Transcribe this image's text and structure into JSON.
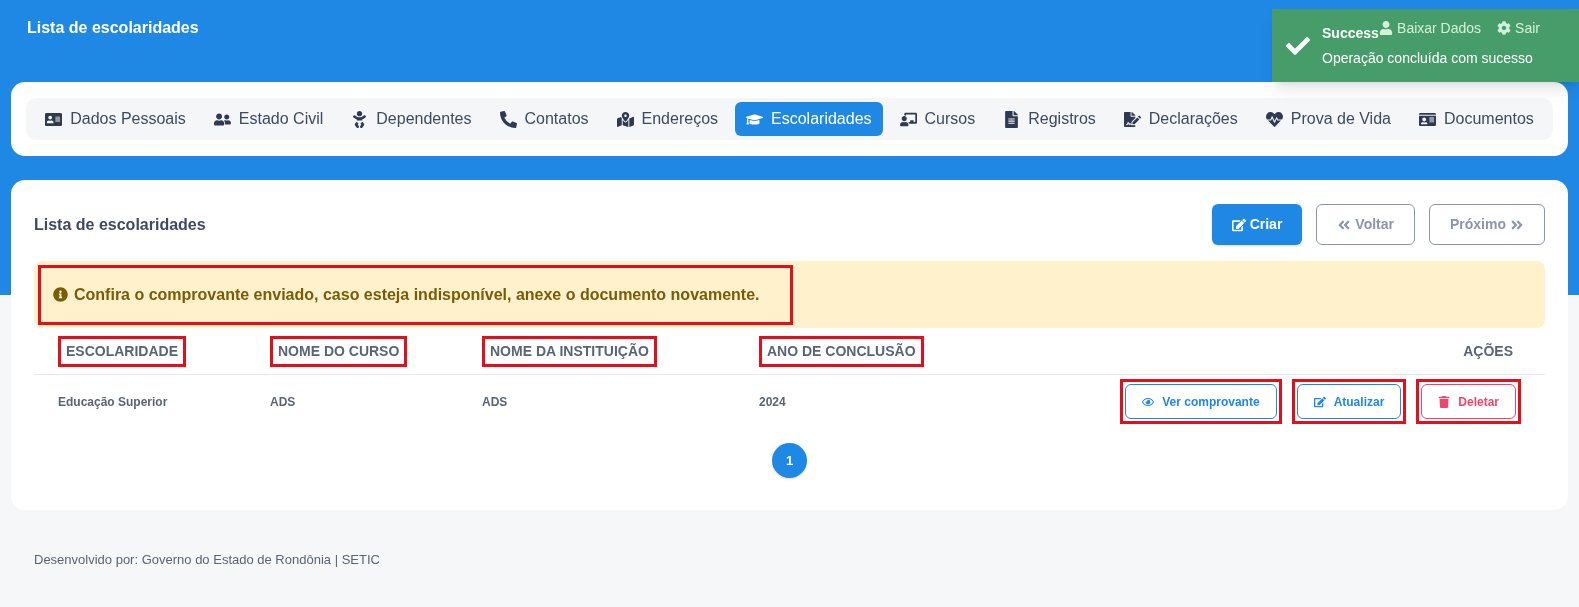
{
  "header": {
    "title": "Lista de escolaridades",
    "links": [
      "Baixar Dados",
      "Sair"
    ]
  },
  "toast": {
    "title": "Success",
    "message": "Operação concluída com sucesso"
  },
  "tabs": [
    {
      "label": "Dados Pessoais",
      "selected": false
    },
    {
      "label": "Estado Civil",
      "selected": false
    },
    {
      "label": "Dependentes",
      "selected": false
    },
    {
      "label": "Contatos",
      "selected": false
    },
    {
      "label": "Endereços",
      "selected": false
    },
    {
      "label": "Escolaridades",
      "selected": true
    },
    {
      "label": "Cursos",
      "selected": false
    },
    {
      "label": "Registros",
      "selected": false
    },
    {
      "label": "Declarações",
      "selected": false
    },
    {
      "label": "Prova de Vida",
      "selected": false
    },
    {
      "label": "Documentos",
      "selected": false
    }
  ],
  "card": {
    "title": "Lista de escolaridades",
    "buttons": [
      {
        "kind": "primary",
        "label": "Criar"
      },
      {
        "kind": "back",
        "label": "Voltar"
      },
      {
        "kind": "next",
        "label": "Próximo"
      }
    ],
    "alert": {
      "text": "Confira o comprovante enviado, caso esteja indisponível, anexe o documento novamente.",
      "highlighted": true
    },
    "table": {
      "columns": [
        {
          "label": "ESCOLARIDADE",
          "highlighted": true
        },
        {
          "label": "NOME DO CURSO",
          "highlighted": true
        },
        {
          "label": "NOME DA INSTITUIÇÃO",
          "highlighted": true
        },
        {
          "label": "ANO DE CONCLUSÃO",
          "highlighted": true
        },
        {
          "label": "AÇÕES",
          "highlighted": false
        }
      ],
      "rows": [
        {
          "cells": [
            "Educação Superior",
            "ADS",
            "ADS",
            "2024"
          ],
          "actions": [
            {
              "kind": "view",
              "label": "Ver comprovante",
              "highlighted": true
            },
            {
              "kind": "edit",
              "label": "Atualizar",
              "highlighted": true
            },
            {
              "kind": "delete",
              "label": "Deletar",
              "highlighted": true
            }
          ]
        }
      ]
    },
    "pagination": [
      {
        "label": "1",
        "selected": true
      }
    ]
  },
  "footer": "Desenvolvido por: Governo do Estado de Rondônia | SETIC"
}
